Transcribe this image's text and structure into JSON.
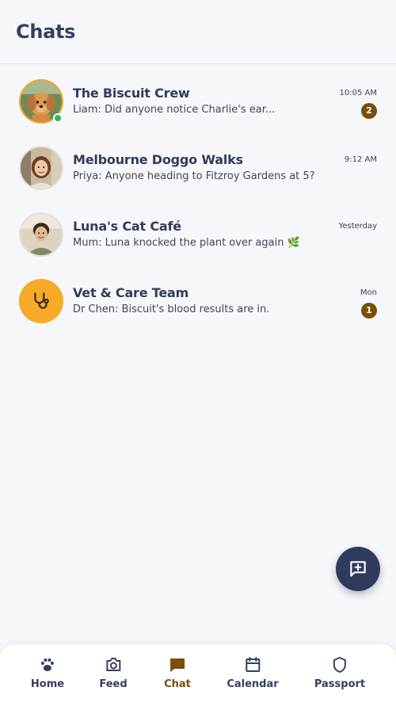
{
  "header": {
    "title": "Chats"
  },
  "chats": [
    {
      "title": "The Biscuit Crew",
      "preview": "Liam: Did anyone notice Charlie's ear...",
      "time": "10:05 AM",
      "unread": "2",
      "online": true
    },
    {
      "title": "Melbourne Doggo Walks",
      "preview": "Priya: Anyone heading to Fitzroy Gardens at 5?",
      "time": "9:12 AM"
    },
    {
      "title": "Luna's Cat Café",
      "preview": "Mum: Luna knocked the plant over again 🌿",
      "time": "Yesterday"
    },
    {
      "title": "Vet & Care Team",
      "preview": "Dr Chen: Biscuit's blood results are in.",
      "time": "Mon",
      "unread": "1"
    }
  ],
  "nav": {
    "items": [
      {
        "label": "Home",
        "icon": "paw-icon"
      },
      {
        "label": "Feed",
        "icon": "camera-icon"
      },
      {
        "label": "Chat",
        "icon": "chat-bubble-icon",
        "active": true
      },
      {
        "label": "Calendar",
        "icon": "calendar-icon"
      },
      {
        "label": "Passport",
        "icon": "shield-icon"
      }
    ]
  },
  "fab": {
    "icon": "new-message-icon"
  },
  "colors": {
    "background": "#f6f7fa",
    "navy": "#2f3a5c",
    "accent_brown": "#7a4f08",
    "vet_orange": "#f7a928",
    "online_green": "#2dbb55"
  }
}
